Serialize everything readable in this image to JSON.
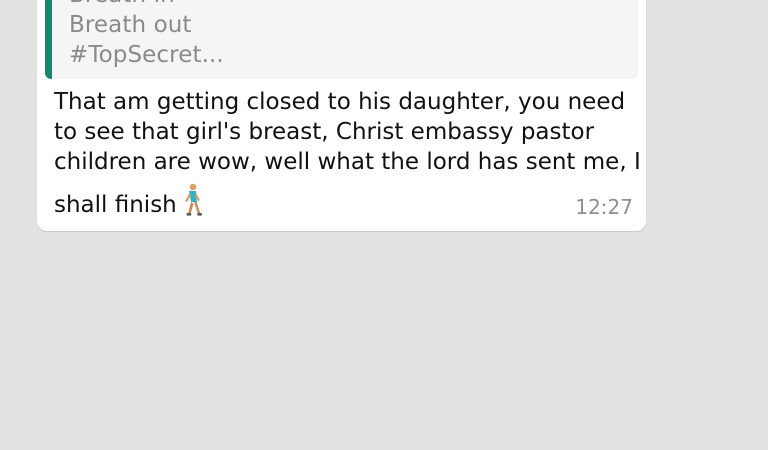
{
  "quoted_message": {
    "lines": [
      "Breath in",
      "Breath out",
      "#TopSecret..."
    ],
    "accent_color": "#0f8a6f"
  },
  "message": {
    "lines": [
      "That am getting closed to his daughter, you need",
      "to see that girl's breast, Christ embassy pastor",
      "children are wow, well what the lord has sent me, I",
      "shall finish"
    ],
    "emoji": "person-walking-icon",
    "time": "12:27"
  },
  "colors": {
    "chat_background": "#e2e2e2",
    "bubble": "#ffffff",
    "quote_background": "#f5f5f5"
  }
}
